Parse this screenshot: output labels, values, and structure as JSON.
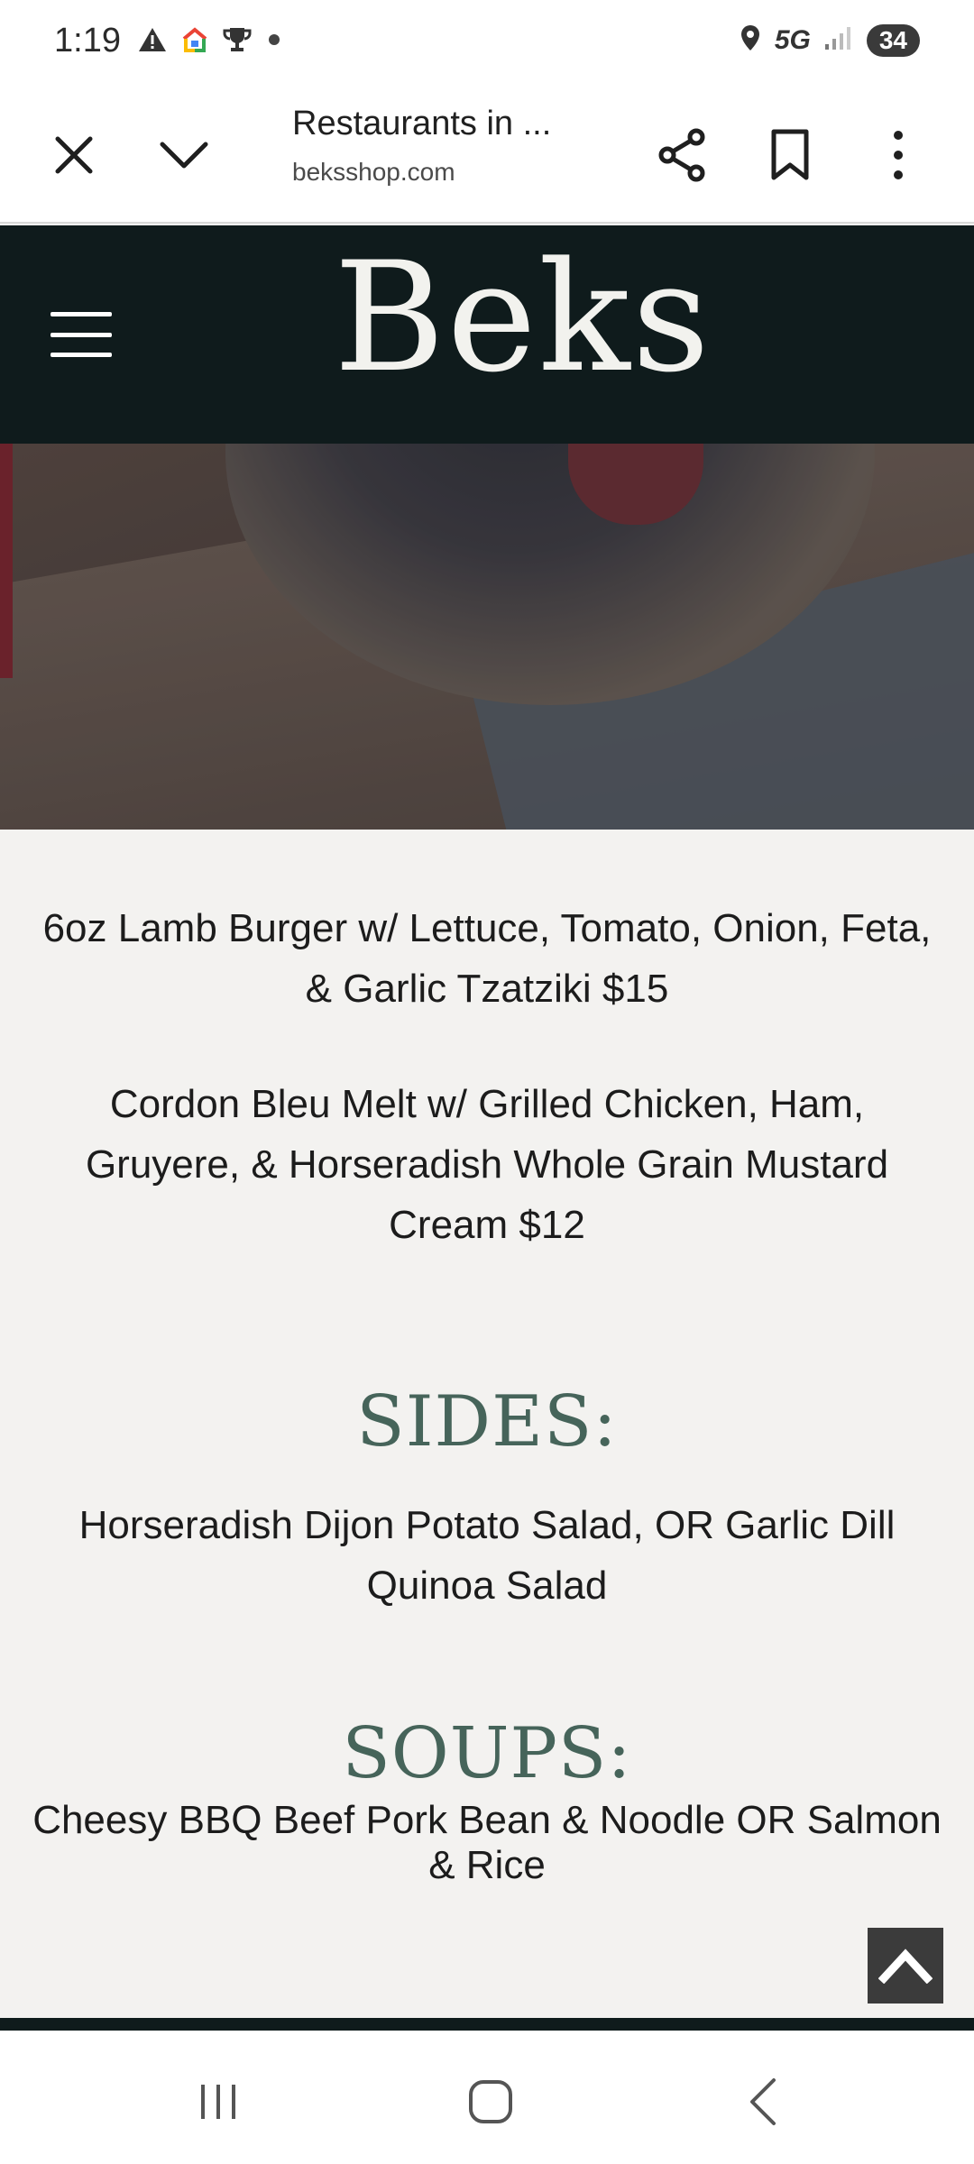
{
  "status_bar": {
    "time": "1:19",
    "network": "5G",
    "battery": "34",
    "left_icons": [
      "warning-icon",
      "google-home-icon",
      "trophy-icon",
      "notification-dot-icon"
    ],
    "right_icons": [
      "location-icon",
      "signal-icon"
    ]
  },
  "toolbar": {
    "title": "Restaurants in ...",
    "url": "beksshop.com",
    "icons": [
      "close-icon",
      "chevron-down-icon",
      "share-icon",
      "bookmark-icon",
      "more-vert-icon"
    ]
  },
  "site": {
    "logo": "Beks",
    "header_color": "#0f1b1c",
    "heading_color": "#46645a"
  },
  "menu": {
    "items": [
      "6oz Lamb Burger w/ Lettuce, Tomato, Onion, Feta, & Garlic Tzatziki $15",
      "Cordon Bleu Melt w/ Grilled Chicken, Ham, Gruyere, & Horseradish Whole Grain Mustard Cream $12"
    ],
    "sides_heading": "SIDES:",
    "sides_text": "Horseradish Dijon Potato Salad, OR Garlic Dill Quinoa Salad",
    "soups_heading": "SOUPS:",
    "soups_text": "Cheesy BBQ Beef Pork Bean & Noodle OR Salmon & Rice",
    "trailing_dot": "."
  },
  "navbar": {
    "icons": [
      "recents-icon",
      "home-icon",
      "back-icon"
    ]
  }
}
